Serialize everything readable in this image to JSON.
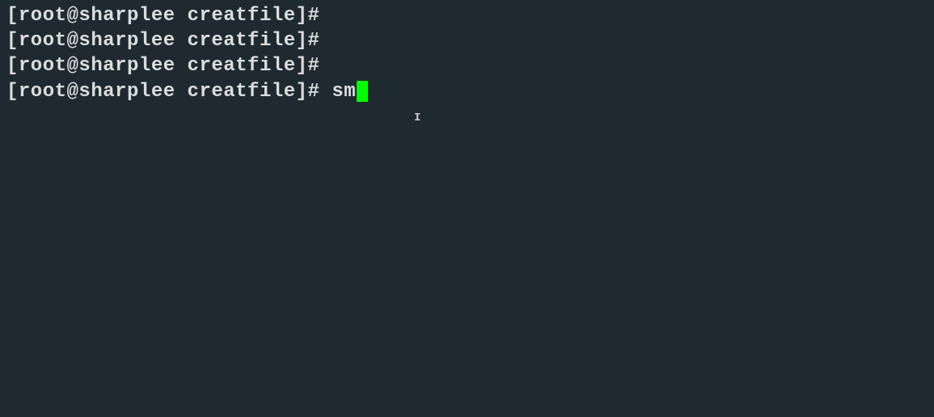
{
  "terminal": {
    "lines": [
      {
        "prompt": "[root@sharplee creatfile]# ",
        "command": "",
        "active": false
      },
      {
        "prompt": "[root@sharplee creatfile]# ",
        "command": "",
        "active": false
      },
      {
        "prompt": "[root@sharplee creatfile]# ",
        "command": "",
        "active": false
      },
      {
        "prompt": "[root@sharplee creatfile]# ",
        "command": "sm",
        "active": true
      }
    ]
  }
}
